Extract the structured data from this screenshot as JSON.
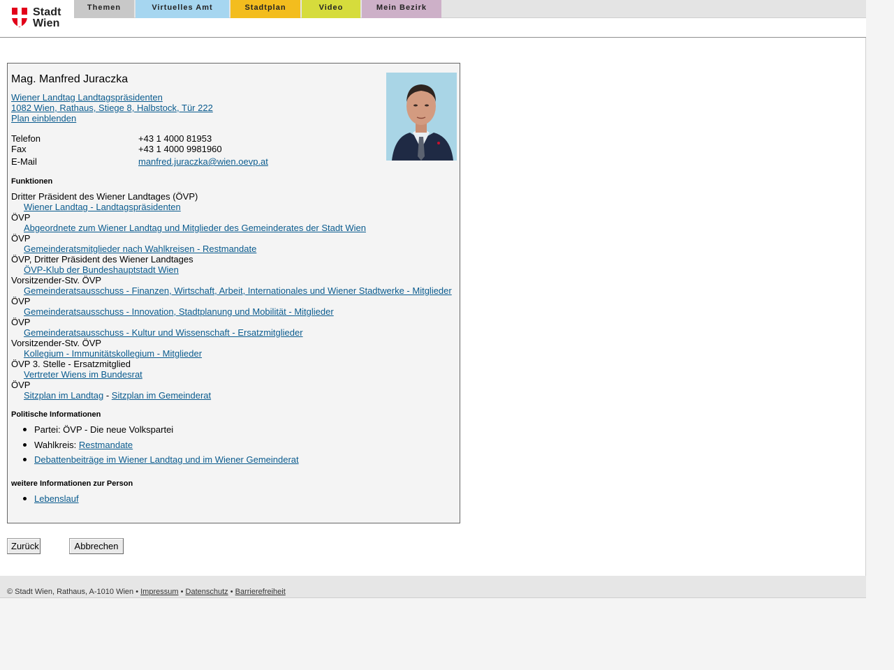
{
  "header": {
    "logo_text_line1": "Stadt",
    "logo_text_line2": "Wien",
    "nav": [
      {
        "label": "Themen",
        "color": "#c8c8c8"
      },
      {
        "label": "Virtuelles Amt",
        "color": "#a6d6f0"
      },
      {
        "label": "Stadtplan",
        "color": "#f3bd1e"
      },
      {
        "label": "Video",
        "color": "#d6dc3c"
      },
      {
        "label": "Mein Bezirk",
        "color": "#cdb0c8"
      }
    ]
  },
  "person": {
    "name": "Mag. Manfred Juraczka",
    "org_link": "Wiener Landtag Landtagspräsidenten",
    "address_link": "1082 Wien, Rathaus, Stiege 8, Halbstock, Tür 222",
    "plan_link": "Plan einblenden",
    "contact": {
      "phone_label": "Telefon",
      "phone": "+43 1 4000 81953",
      "fax_label": "Fax",
      "fax": "+43 1 4000 9981960",
      "email_label": "E-Mail",
      "email": "manfred.juraczka@wien.oevp.at"
    }
  },
  "functions": {
    "heading": "Funktionen",
    "entries": [
      {
        "text": "Dritter Präsident des Wiener Landtages (ÖVP)",
        "link": "Wiener Landtag - Landtagspräsidenten"
      },
      {
        "text": "ÖVP",
        "link": "Abgeordnete zum Wiener Landtag und Mitglieder des Gemeinderates der Stadt Wien"
      },
      {
        "text": "ÖVP",
        "link": "Gemeinderatsmitglieder nach Wahlkreisen - Restmandate"
      },
      {
        "text": "ÖVP, Dritter Präsident des Wiener Landtages",
        "link": "ÖVP-Klub der Bundeshauptstadt Wien"
      },
      {
        "text": "Vorsitzender-Stv. ÖVP",
        "link": "Gemeinderatsausschuss - Finanzen, Wirtschaft, Arbeit, Internationales und Wiener Stadtwerke - Mitglieder"
      },
      {
        "text": "ÖVP",
        "link": "Gemeinderatsausschuss - Innovation, Stadtplanung und Mobilität - Mitglieder"
      },
      {
        "text": "ÖVP",
        "link": "Gemeinderatsausschuss - Kultur und Wissenschaft - Ersatzmitglieder"
      },
      {
        "text": "Vorsitzender-Stv. ÖVP",
        "link": "Kollegium - Immunitätskollegium - Mitglieder"
      },
      {
        "text": "ÖVP 3. Stelle - Ersatzmitglied",
        "link": "Vertreter Wiens im Bundesrat"
      },
      {
        "text": "ÖVP",
        "link": ""
      }
    ],
    "sitzplan_landtag": "Sitzplan im Landtag",
    "separator": "-",
    "sitzplan_gemeinderat": "Sitzplan im Gemeinderat"
  },
  "political": {
    "heading": "Politische Informationen",
    "party": "Partei: ÖVP - Die neue Volkspartei",
    "wahlkreis_label": "Wahlkreis:",
    "wahlkreis_link": "Restmandate",
    "debates_link": "Debattenbeiträge im Wiener Landtag und im Wiener Gemeinderat"
  },
  "more": {
    "heading": "weitere Informationen zur Person",
    "cv_link": "Lebenslauf"
  },
  "buttons": {
    "back": "Zurück",
    "cancel": "Abbrechen"
  },
  "footer": {
    "copyright": "© Stadt Wien, Rathaus, A-1010 Wien",
    "bullet": "•",
    "impressum": "Impressum",
    "datenschutz": "Datenschutz",
    "barrierefreiheit": "Barrierefreiheit"
  }
}
